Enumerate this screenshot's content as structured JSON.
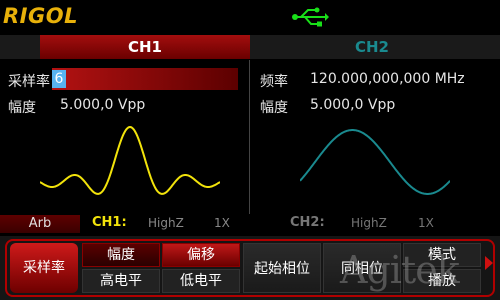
{
  "header": {
    "logo": "RIGOL",
    "usb_icon": "usb-icon"
  },
  "channels": {
    "ch1": "CH1",
    "ch2": "CH2",
    "active": "CH1"
  },
  "ch1_panel": {
    "rate_label": "采样率",
    "rate_value": "6",
    "amp_label": "幅度",
    "amp_value": "5.000,0 Vpp",
    "waveform": "arbitrary"
  },
  "ch2_panel": {
    "freq_label": "频率",
    "freq_value": "120.000,000,000 MHz",
    "amp_label": "幅度",
    "amp_value": "5.000,0 Vpp",
    "waveform": "sine"
  },
  "status": {
    "mode": "Arb",
    "ch1_label": "CH1:",
    "ch1_impedance": "HighZ",
    "ch1_scale": "1X",
    "ch2_label": "CH2:",
    "ch2_impedance": "HighZ",
    "ch2_scale": "1X"
  },
  "menu": {
    "rate": "采样率",
    "amp": "幅度",
    "offset": "偏移",
    "high": "高电平",
    "low": "低电平",
    "phase": "起始相位",
    "align": "同相位",
    "mode": "模式",
    "play": "播放"
  },
  "watermark": "Agitek",
  "colors": {
    "ch1_accent": "#f2e30b",
    "ch2_accent": "#1a8a8f",
    "active_red": "#b00000",
    "logo": "#e8b10a"
  }
}
